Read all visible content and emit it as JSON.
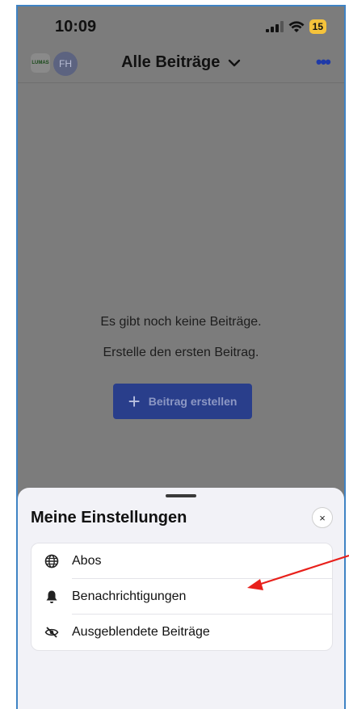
{
  "status_bar": {
    "time": "10:09",
    "battery": "15"
  },
  "nav": {
    "logo_text": "LUMAS",
    "avatar_initials": "FH",
    "title": "Alle Beiträge",
    "more_label": "•••"
  },
  "empty_state": {
    "line1": "Es gibt noch keine Beiträge.",
    "line2": "Erstelle den ersten Beitrag.",
    "create_button": "Beitrag erstellen"
  },
  "sheet": {
    "title": "Meine Einstellungen",
    "close_label": "×",
    "items": [
      {
        "label": "Abos",
        "icon": "globe-icon"
      },
      {
        "label": "Benachrichtigungen",
        "icon": "bell-icon"
      },
      {
        "label": "Ausgeblendete Beiträge",
        "icon": "eye-slash-icon"
      }
    ]
  },
  "annotation": {
    "color": "#e8201b"
  }
}
